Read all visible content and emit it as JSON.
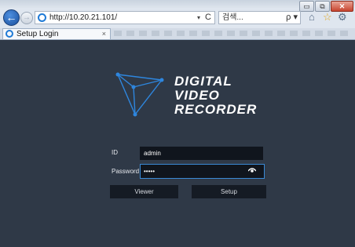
{
  "browser": {
    "window_buttons": {
      "minimize": "▭",
      "maximize": "⧉",
      "close": "✕"
    },
    "back_glyph": "←",
    "forward_glyph": "→",
    "address_url": "http://10.20.21.101/",
    "address_dropdown": "▾",
    "refresh_glyph": "C",
    "search_text": "검색...",
    "search_glyph": "ρ ▾",
    "home_glyph": "⌂",
    "star_glyph": "☆",
    "gear_glyph": "⚙",
    "tab": {
      "title": "Setup Login",
      "close": "×"
    },
    "icons": {
      "back": "back-arrow-icon",
      "forward": "forward-arrow-icon",
      "ie": "ie-logo-icon",
      "refresh": "refresh-icon",
      "search": "search-icon",
      "home": "home-icon",
      "favorites": "star-icon",
      "tools": "gear-icon"
    }
  },
  "page": {
    "brand_lines": [
      "DIGITAL",
      "VIDEO",
      "RECORDER"
    ],
    "id_label": "ID",
    "id_value": "admin",
    "password_label": "Password",
    "password_value": "•••••",
    "viewer_button": "Viewer",
    "setup_button": "Setup",
    "icons": {
      "logo": "triangle-logo-icon",
      "reveal": "eye-icon"
    },
    "colors": {
      "background": "#2f3947",
      "field": "#10151d",
      "focus": "#3a8ad6",
      "logo": "#2e86de"
    }
  }
}
